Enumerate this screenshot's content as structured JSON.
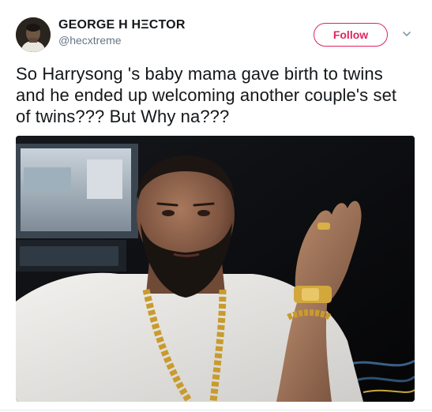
{
  "tweet": {
    "display_name": "GEORGE H HΞCTOR",
    "username": "@hecxtreme",
    "follow_label": "Follow",
    "text": "So Harrysong 's baby mama gave birth to twins and he ended up welcoming another couple's set of twins??? But Why na???"
  },
  "icons": {
    "menu": "chevron-down-icon"
  },
  "colors": {
    "follow_accent": "#e0245e",
    "username": "#657786",
    "text": "#14171a"
  }
}
